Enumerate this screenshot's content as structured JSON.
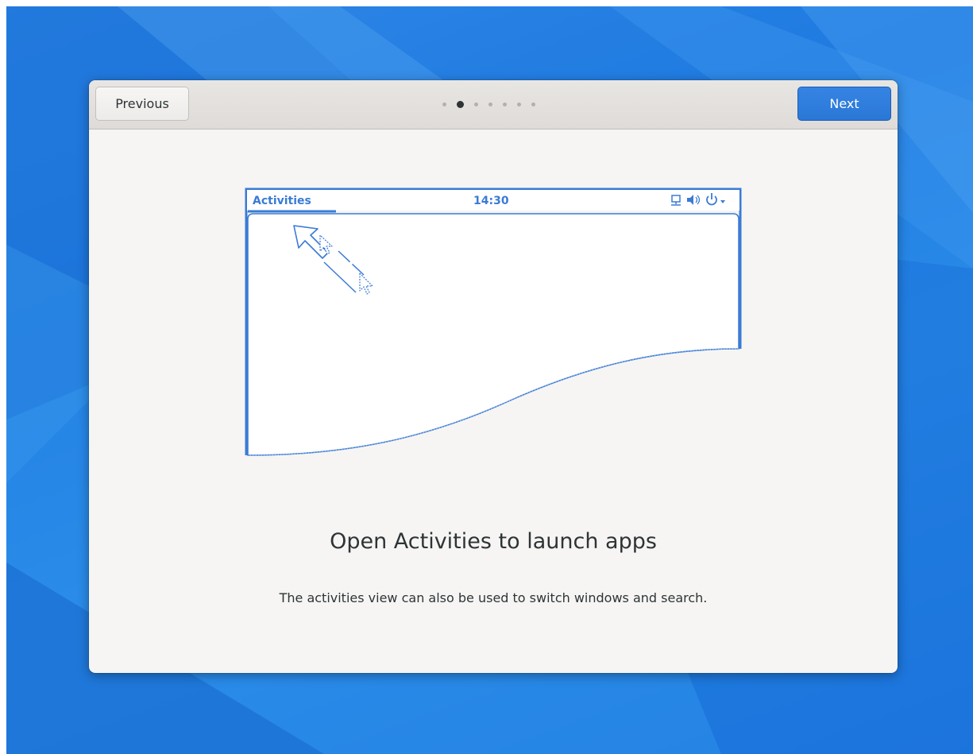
{
  "headerbar": {
    "previous_label": "Previous",
    "next_label": "Next",
    "page_count": 7,
    "current_page": 2
  },
  "illustration": {
    "activities_label": "Activities",
    "clock": "14:30",
    "status_icons": [
      "network-icon",
      "volume-icon",
      "power-icon",
      "dropdown-arrow-icon"
    ]
  },
  "content": {
    "title": "Open Activities to launch apps",
    "description": "The activities view can also be used to switch windows and search."
  },
  "colors": {
    "accent": "#3584e4",
    "illustration_blue": "#3a7bd5",
    "dialog_bg": "#f6f5f4"
  }
}
